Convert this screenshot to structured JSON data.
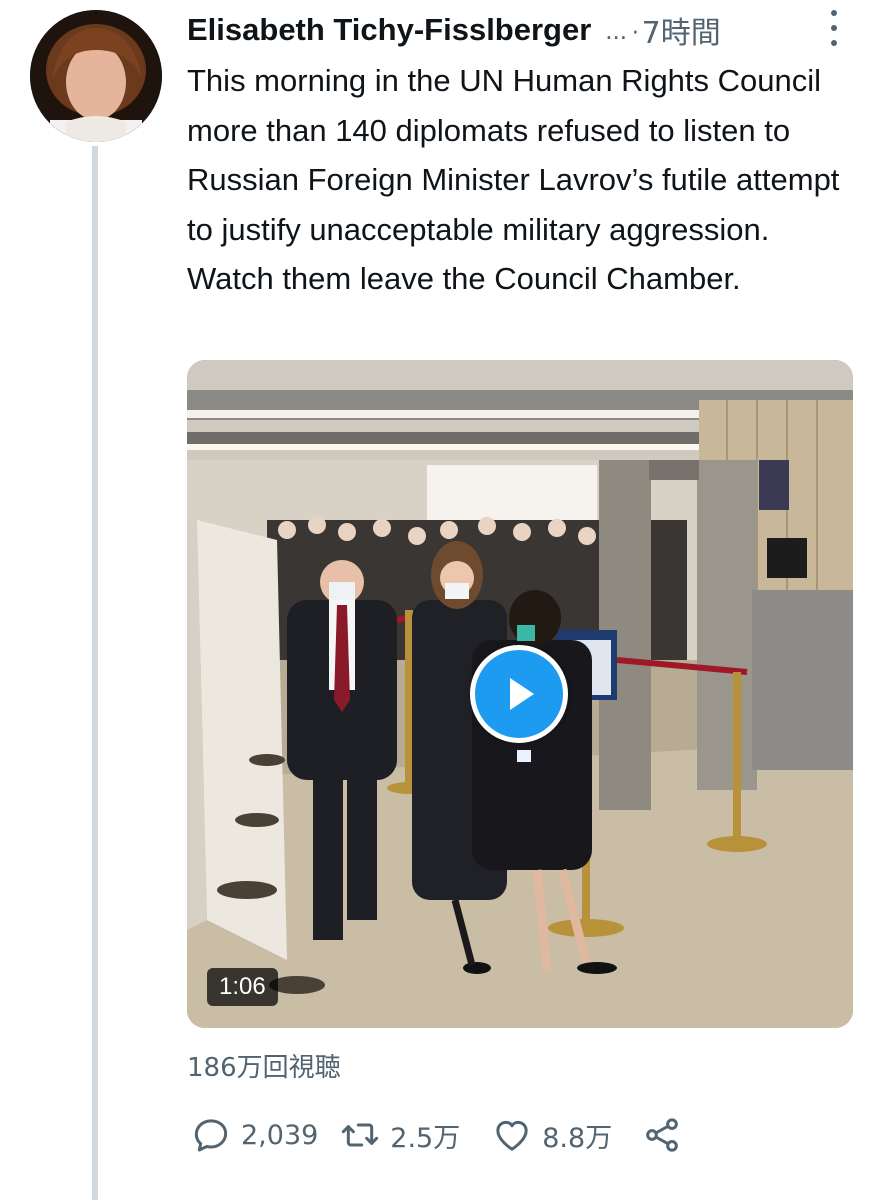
{
  "author": {
    "name": "Elisabeth Tichy-Fisslberger",
    "handle_truncated": "...",
    "separator": "·",
    "timestamp": "7時間"
  },
  "tweet": {
    "text": "This morning in the UN Human Rights Council more than 140 diplomats refused to listen to Russian Foreign Minister Lavrov’s futile attempt to justify unacceptable military aggression. Watch them leave the Council Chamber."
  },
  "media": {
    "type": "video",
    "duration": "1:06",
    "play_icon": "play-icon"
  },
  "stats": {
    "views": "186万回視聴"
  },
  "actions": {
    "reply_count": "2,039",
    "retweet_count": "2.5万",
    "like_count": "8.8万",
    "icons": [
      "reply-icon",
      "retweet-icon",
      "like-icon",
      "share-icon"
    ]
  },
  "colors": {
    "accent": "#1d9bf0",
    "secondary_text": "#536471",
    "primary_text": "#0f1419",
    "thread_line": "#cfd9de"
  }
}
